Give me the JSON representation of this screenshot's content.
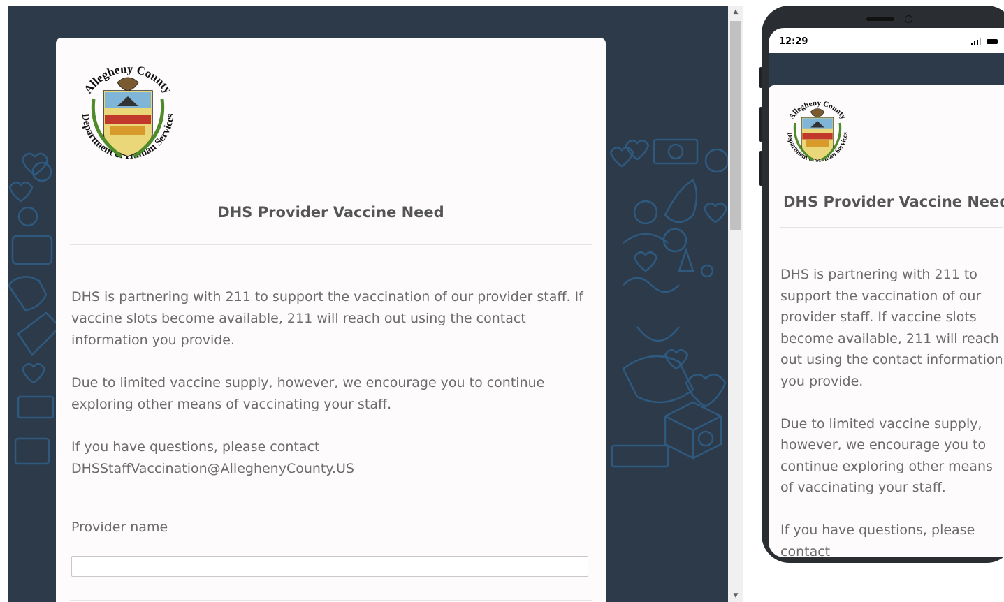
{
  "logo": {
    "top_text": "Allegheny County",
    "bottom_text": "Department of Human Services"
  },
  "form": {
    "title": "DHS Provider Vaccine Need",
    "paragraphs": [
      "DHS is partnering with 211 to support the vaccination of our provider staff.  If vaccine slots become available, 211 will reach out using the contact information you provide.",
      "Due to limited vaccine supply, however, we encourage you to continue exploring other means of vaccinating your staff.",
      "If you have questions, please contact DHSStaffVaccination@AlleghenyCounty.US"
    ],
    "field_label": "Provider name",
    "field_value": ""
  },
  "mobile": {
    "time": "12:29",
    "visible_tail": "contact DHSStaffVaccination@AlleghenyCounty.US"
  },
  "colors": {
    "background": "#2c3a4a",
    "pattern": "#2f5a80",
    "card": "#fdfbfc",
    "text": "#6b6b6b",
    "title": "#555555"
  },
  "icons": [
    "heart-icon",
    "dollar-icon",
    "hand-icon",
    "box-icon",
    "person-icon",
    "signal-icon",
    "battery-icon"
  ]
}
